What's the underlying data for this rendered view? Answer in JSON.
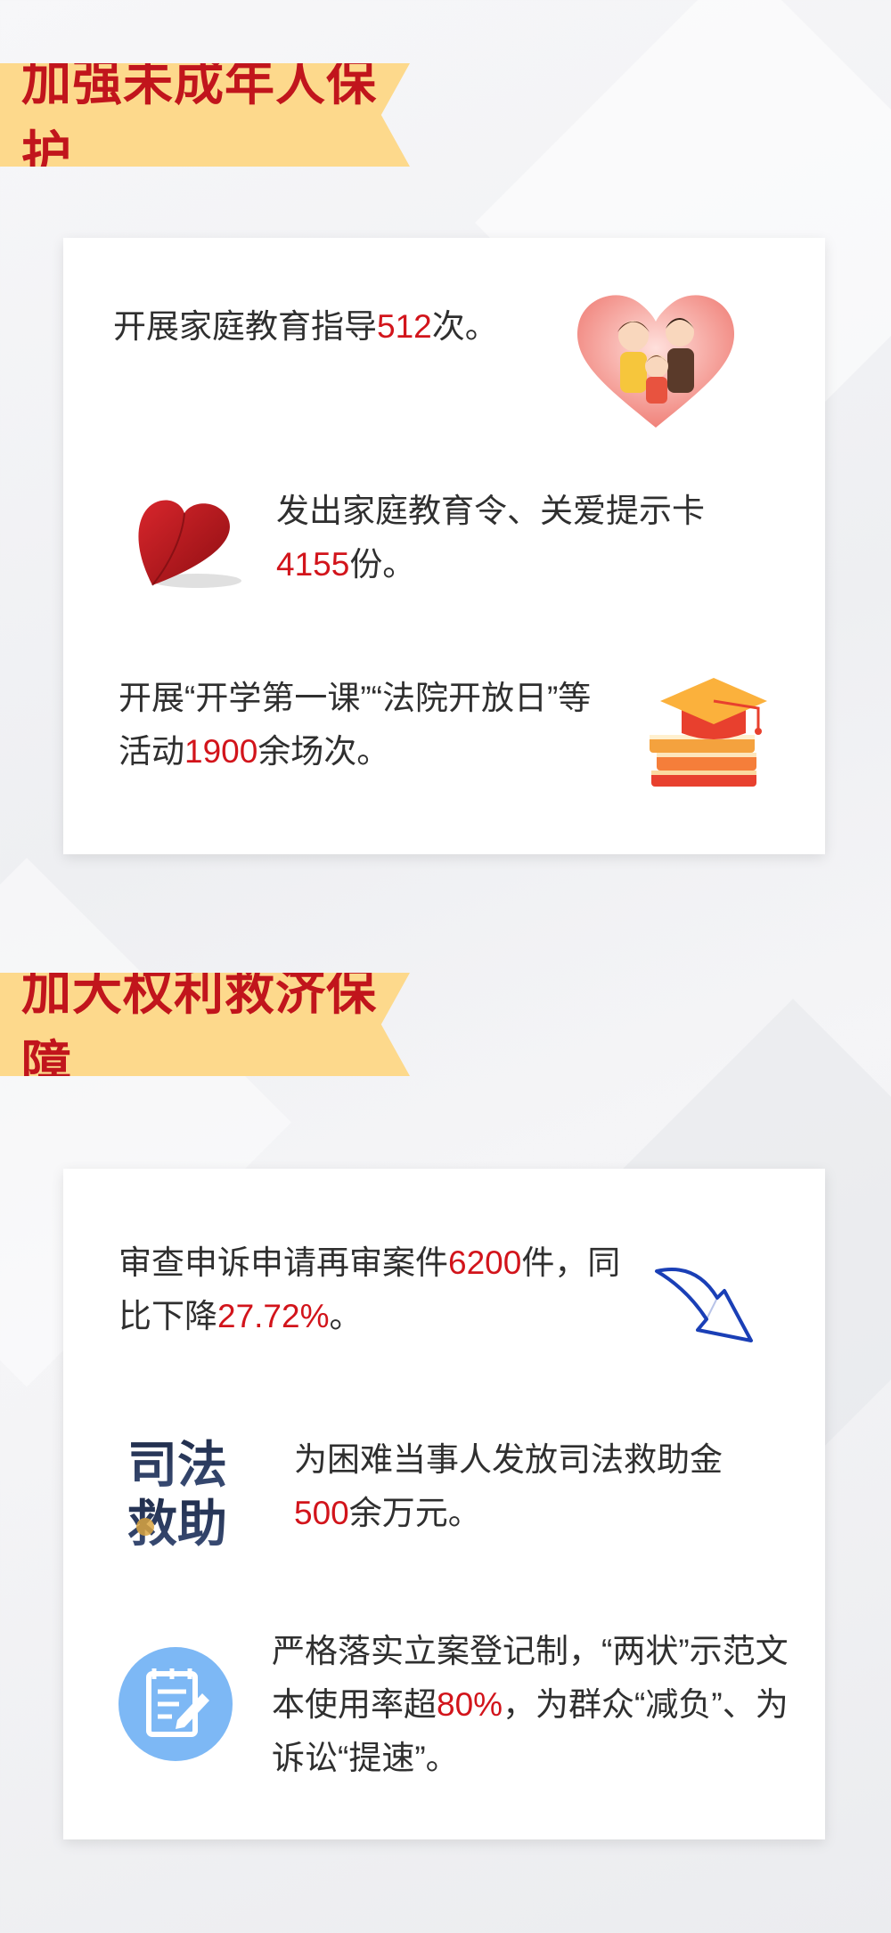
{
  "sections": [
    {
      "title": "加强未成年人保护",
      "items": [
        {
          "pre": "开展家庭教育指导",
          "num": "512",
          "post": "次。",
          "icon": "family-heart-icon"
        },
        {
          "pre": "发出家庭教育令、关爱提示卡",
          "num": "4155",
          "post": "份。",
          "icon": "red-heart-icon"
        },
        {
          "pre": "开展“开学第一课”“法院开放日”等活动",
          "num": "1900",
          "post": "余场次。",
          "icon": "graduation-books-icon"
        }
      ]
    },
    {
      "title": "加大权利救济保障",
      "items": [
        {
          "pre": "审查申诉申请再审案件",
          "num": "6200",
          "mid": "件，同比下降",
          "num2": "27.72%",
          "post": "。",
          "icon": "down-arrow-icon"
        },
        {
          "pre": "为困难当事人发放司法救助金",
          "num": "500",
          "post": "余万元。",
          "icon": "judicial-aid-icon",
          "icon_text_1": "司法",
          "icon_text_2": "救助"
        },
        {
          "pre": "严格落实立案登记制，“两状”示范文本使用率超",
          "num": "80%",
          "post": "，为群众“减负”、为诉讼“提速”。",
          "icon": "document-edit-icon"
        }
      ]
    }
  ],
  "colors": {
    "accent_red": "#d2141b",
    "banner_bg": "#fdd98c",
    "title_red": "#c1151c",
    "aid_blue": "#7db8f5"
  }
}
